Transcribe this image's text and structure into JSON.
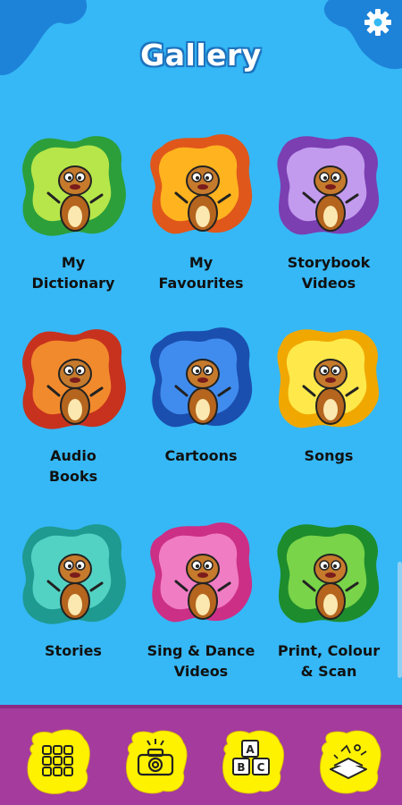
{
  "header": {
    "title": "Gallery",
    "settings_icon": "gear-icon"
  },
  "tiles": [
    {
      "label": "My\nDictionary",
      "colors": [
        "#2c9f3a",
        "#b7e64a"
      ],
      "icon": "dictionary-giraffe-icon"
    },
    {
      "label": "My\nFavourites",
      "colors": [
        "#e0571b",
        "#ffb41f"
      ],
      "icon": "favourites-bear-icon"
    },
    {
      "label": "Storybook\nVideos",
      "colors": [
        "#7b3fb2",
        "#c39bee"
      ],
      "icon": "elephant-video-icon"
    },
    {
      "label": "Audio\nBooks",
      "colors": [
        "#c7321e",
        "#f08a2c"
      ],
      "icon": "headphones-giraffe-icon"
    },
    {
      "label": "Cartoons",
      "colors": [
        "#1b4faf",
        "#3f8bee"
      ],
      "icon": "juggling-clown-icon"
    },
    {
      "label": "Songs",
      "colors": [
        "#f0a800",
        "#ffe94a"
      ],
      "icon": "singing-bear-icon"
    },
    {
      "label": "Stories",
      "colors": [
        "#1f9a91",
        "#52d2c3"
      ],
      "icon": "storytelling-animals-icon"
    },
    {
      "label": "Sing & Dance\nVideos",
      "colors": [
        "#cc2f86",
        "#f07cc3"
      ],
      "icon": "dancing-giraffe-icon"
    },
    {
      "label": "Print, Colour\n& Scan",
      "colors": [
        "#1d8c2c",
        "#79d44a"
      ],
      "icon": "painting-giraffe-icon"
    }
  ],
  "bottom_nav": [
    {
      "icon": "grid-icon"
    },
    {
      "icon": "camera-icon"
    },
    {
      "icon": "abc-blocks-icon"
    },
    {
      "icon": "storybook-icon"
    }
  ],
  "colors": {
    "background": "#35b8f5",
    "bottom_bar": "#a53c9d",
    "nav_button": "#fff200"
  }
}
